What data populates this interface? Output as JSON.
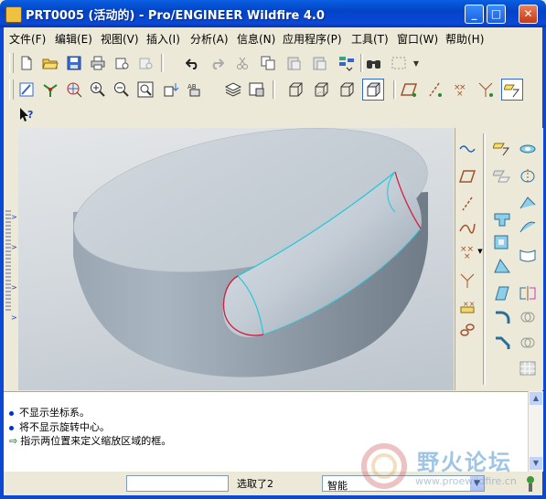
{
  "window": {
    "title": "PRT0005 (活动的) - Pro/ENGINEER Wildfire 4.0",
    "minimize_glyph": "_",
    "maximize_glyph": "□",
    "close_glyph": "✕"
  },
  "menu": {
    "items": [
      "文件(F)",
      "编辑(E)",
      "视图(V)",
      "插入(I)",
      "分析(A)",
      "信息(N)",
      "应用程序(P)",
      "工具(T)",
      "窗口(W)",
      "帮助(H)"
    ]
  },
  "toolbar1": {
    "icons": [
      "new-file-icon",
      "open-folder-icon",
      "save-icon",
      "print-icon",
      "send-mail-icon",
      "mail-disabled-icon",
      "undo-icon",
      "redo-icon",
      "cut-icon",
      "copy-icon",
      "paste-icon",
      "paste-special-icon",
      "regenerate-icon",
      "find-icon",
      "select-box-icon"
    ]
  },
  "toolbar2": {
    "icons": [
      "repaint-icon",
      "spin-center-icon",
      "orient-mode-icon",
      "zoom-in-icon",
      "zoom-out-icon",
      "refit-icon",
      "reorient-icon",
      "saved-views-icon",
      "layers-icon",
      "view-manager-icon",
      "wireframe-icon",
      "hidden-line-icon",
      "no-hidden-icon",
      "shading-icon",
      "datum-planes-icon",
      "datum-axes-icon",
      "datum-points-icon",
      "coord-sys-icon",
      "annotations-icon"
    ]
  },
  "toolbar3": {
    "icons": [
      "whats-this-icon"
    ]
  },
  "messages": [
    {
      "type": "info",
      "text": "不显示坐标系。"
    },
    {
      "type": "info",
      "text": "将不显示旋转中心。"
    },
    {
      "type": "prompt",
      "text": "指示两位置来定义缩放区域的框。"
    }
  ],
  "status": {
    "selection_text": "选取了2",
    "filter_value": "智能"
  },
  "watermark": {
    "text": "野火论坛",
    "url": "www.proewildfire.cn"
  }
}
